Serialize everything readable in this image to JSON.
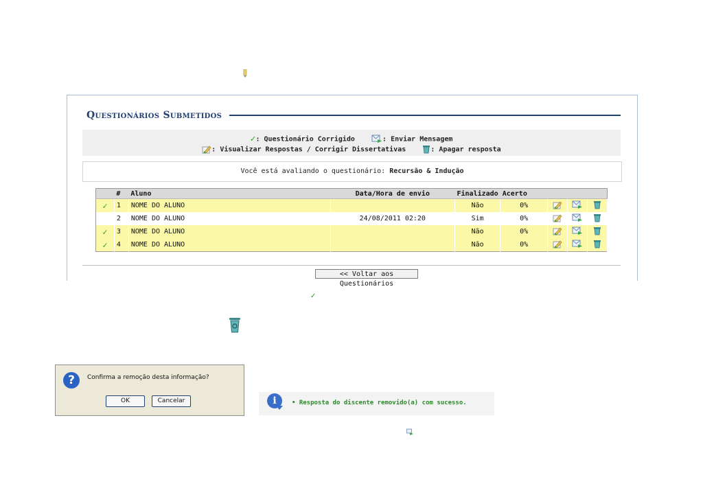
{
  "panel": {
    "title": "Questionários Submetidos",
    "legend": {
      "corrigido": ": Questionário Corrigido",
      "enviar": ": Enviar Mensagem",
      "visualizar": ": Visualizar Respostas / Corrigir Dissertativas",
      "apagar": ": Apagar resposta"
    },
    "info_prefix": "Você está avaliando o questionário:",
    "quiz_name": "Recursão & Indução"
  },
  "table": {
    "headers": {
      "num": "#",
      "aluno": "Aluno",
      "data": "Data/Hora de envio",
      "finalizado": "Finalizado",
      "acerto": "Acerto"
    },
    "rows": [
      {
        "corrigido": true,
        "num": "1",
        "aluno": "NOME DO ALUNO",
        "data": "",
        "finalizado": "Não",
        "acerto": "0%"
      },
      {
        "corrigido": false,
        "num": "2",
        "aluno": "NOME DO ALUNO",
        "data": "24/08/2011 02:20",
        "finalizado": "Sim",
        "acerto": "0%"
      },
      {
        "corrigido": true,
        "num": "3",
        "aluno": "NOME DO ALUNO",
        "data": "",
        "finalizado": "Não",
        "acerto": "0%"
      },
      {
        "corrigido": true,
        "num": "4",
        "aluno": "NOME DO ALUNO",
        "data": "",
        "finalizado": "Não",
        "acerto": "0%"
      }
    ]
  },
  "back_button": "<< Voltar aos Questionários",
  "dialog": {
    "message": "Confirma a remoção desta informação?",
    "ok": "OK",
    "cancel": "Cancelar"
  },
  "success": {
    "message": "• Resposta do discente removido(a) com sucesso."
  },
  "colors": {
    "title": "#1f3f73",
    "row_highlight": "#fbf9a8",
    "success_text": "#2a8a2a",
    "check": "#33a033"
  }
}
